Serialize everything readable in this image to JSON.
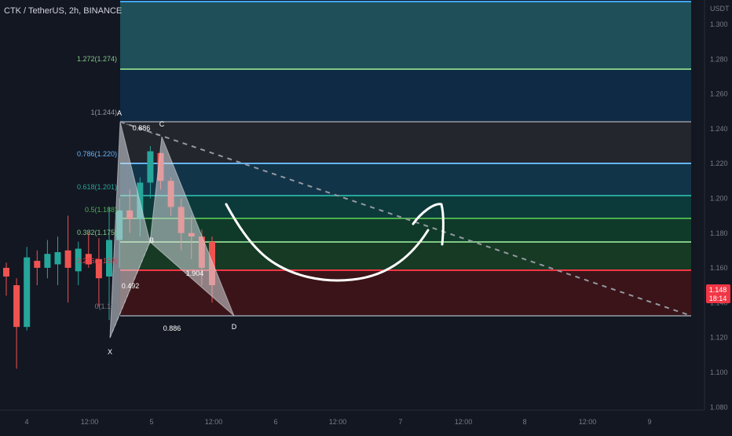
{
  "header": {
    "symbol": "CTK / TetherUS, 2h, BINANCE"
  },
  "price_axis": {
    "currency": "USDT",
    "ticks": [
      "1.300",
      "1.280",
      "1.260",
      "1.240",
      "1.220",
      "1.200",
      "1.180",
      "1.160",
      "1.140",
      "1.120",
      "1.100",
      "1.080"
    ],
    "last_price": "1.148",
    "countdown": "18:14"
  },
  "time_axis": {
    "ticks": [
      "4",
      "12:00",
      "5",
      "12:00",
      "6",
      "12:00",
      "7",
      "12:00",
      "8",
      "12:00",
      "9"
    ]
  },
  "fib_levels": [
    {
      "label": "1.272(1.274)",
      "color": "#81c784"
    },
    {
      "label": "1(1.244)",
      "color": "#9598a1"
    },
    {
      "label": "0.786(1.220)",
      "color": "#64b5f6"
    },
    {
      "label": "0.618(1.201)",
      "color": "#26a69a"
    },
    {
      "label": "0.5(1.188)",
      "color": "#4caf50"
    },
    {
      "label": "0.382(1.175)",
      "color": "#81c784"
    },
    {
      "label": "0.236(1.159)",
      "color": "#f23645"
    },
    {
      "label": "0(1.13)",
      "color": "#787b86"
    }
  ],
  "pattern": {
    "points": [
      "X",
      "A",
      "B",
      "C",
      "D"
    ],
    "ratios": [
      "0.886",
      "0.492",
      "1.904",
      "0.886"
    ]
  },
  "colors": {
    "background": "#131722",
    "up": "#26a69a",
    "down": "#ef5350",
    "pattern_fill": "#d6d8de",
    "drawing": "#ffffff"
  },
  "chart_data": {
    "type": "candlestick",
    "ylim": [
      1.075,
      1.305
    ],
    "candles": [
      {
        "o": 1.16,
        "h": 1.163,
        "l": 1.144,
        "c": 1.155
      },
      {
        "o": 1.15,
        "h": 1.154,
        "l": 1.102,
        "c": 1.126
      },
      {
        "o": 1.126,
        "h": 1.172,
        "l": 1.124,
        "c": 1.166
      },
      {
        "o": 1.164,
        "h": 1.17,
        "l": 1.15,
        "c": 1.16
      },
      {
        "o": 1.16,
        "h": 1.176,
        "l": 1.154,
        "c": 1.168
      },
      {
        "o": 1.162,
        "h": 1.178,
        "l": 1.15,
        "c": 1.169
      },
      {
        "o": 1.17,
        "h": 1.19,
        "l": 1.14,
        "c": 1.16
      },
      {
        "o": 1.158,
        "h": 1.175,
        "l": 1.15,
        "c": 1.171
      },
      {
        "o": 1.168,
        "h": 1.18,
        "l": 1.16,
        "c": 1.162
      },
      {
        "o": 1.165,
        "h": 1.177,
        "l": 1.138,
        "c": 1.154
      },
      {
        "o": 1.155,
        "h": 1.195,
        "l": 1.13,
        "c": 1.176
      },
      {
        "o": 1.176,
        "h": 1.2,
        "l": 1.16,
        "c": 1.193
      },
      {
        "o": 1.193,
        "h": 1.205,
        "l": 1.18,
        "c": 1.188
      },
      {
        "o": 1.188,
        "h": 1.212,
        "l": 1.178,
        "c": 1.209
      },
      {
        "o": 1.209,
        "h": 1.23,
        "l": 1.2,
        "c": 1.227
      },
      {
        "o": 1.226,
        "h": 1.226,
        "l": 1.205,
        "c": 1.21
      },
      {
        "o": 1.21,
        "h": 1.212,
        "l": 1.19,
        "c": 1.195
      },
      {
        "o": 1.195,
        "h": 1.2,
        "l": 1.17,
        "c": 1.18
      },
      {
        "o": 1.18,
        "h": 1.19,
        "l": 1.165,
        "c": 1.178
      },
      {
        "o": 1.178,
        "h": 1.182,
        "l": 1.15,
        "c": 1.16
      },
      {
        "o": 1.175,
        "h": 1.178,
        "l": 1.14,
        "c": 1.15
      }
    ]
  }
}
